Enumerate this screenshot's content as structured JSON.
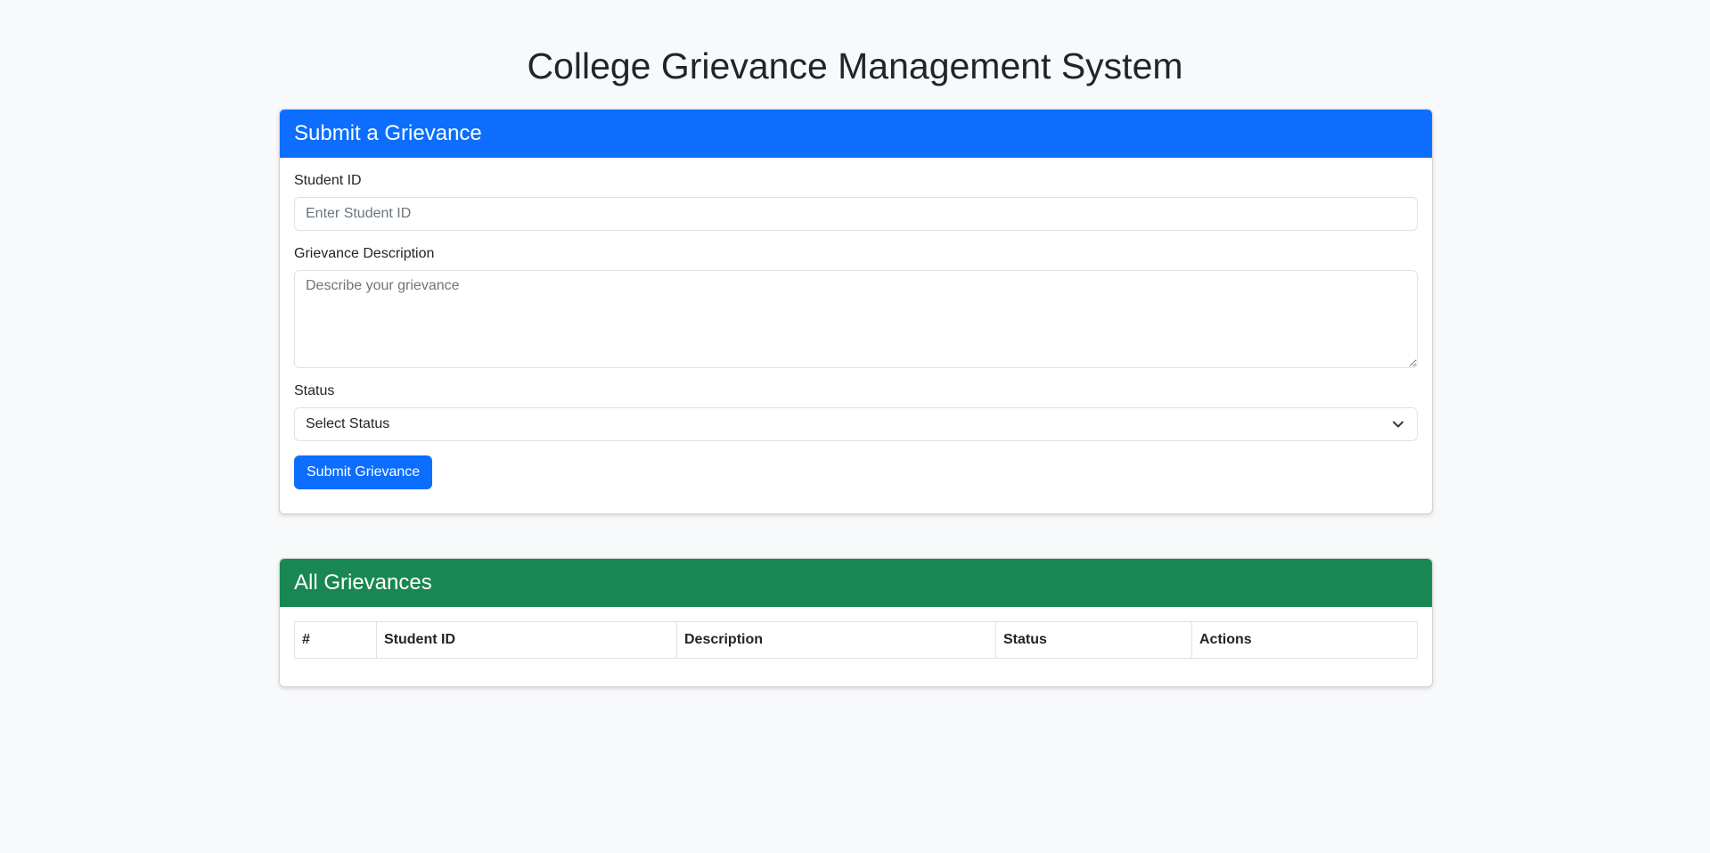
{
  "page": {
    "title": "College Grievance Management System"
  },
  "submit_card": {
    "header": "Submit a Grievance",
    "student_id": {
      "label": "Student ID",
      "value": "",
      "placeholder": "Enter Student ID"
    },
    "description": {
      "label": "Grievance Description",
      "value": "",
      "placeholder": "Describe your grievance"
    },
    "status": {
      "label": "Status",
      "selected": "Select Status",
      "icon": "chevron-down-icon"
    },
    "submit_label": "Submit Grievance"
  },
  "list_card": {
    "header": "All Grievances",
    "columns": [
      "#",
      "Student ID",
      "Description",
      "Status",
      "Actions"
    ],
    "rows": []
  },
  "colors": {
    "primary": "#0d6efd",
    "success": "#198754",
    "background": "#f8f9fa"
  }
}
